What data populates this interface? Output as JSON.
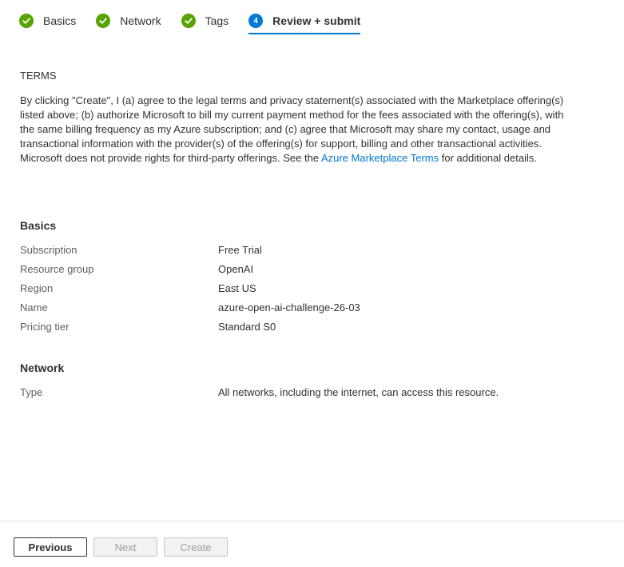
{
  "steps": [
    {
      "label": "Basics",
      "state": "done"
    },
    {
      "label": "Network",
      "state": "done"
    },
    {
      "label": "Tags",
      "state": "done"
    },
    {
      "label": "Review + submit",
      "state": "current",
      "number": "4"
    }
  ],
  "terms": {
    "title": "TERMS",
    "text_before_link": "By clicking \"Create\", I (a) agree to the legal terms and privacy statement(s) associated with the Marketplace offering(s) listed above; (b) authorize Microsoft to bill my current payment method for the fees associated with the offering(s), with the same billing frequency as my Azure subscription; and (c) agree that Microsoft may share my contact, usage and transactional information with the provider(s) of the offering(s) for support, billing and other transactional activities. Microsoft does not provide rights for third-party offerings. See the ",
    "link_text": "Azure Marketplace Terms",
    "text_after_link": " for additional details."
  },
  "basics": {
    "title": "Basics",
    "rows": [
      {
        "label": "Subscription",
        "value": "Free Trial"
      },
      {
        "label": "Resource group",
        "value": "OpenAI"
      },
      {
        "label": "Region",
        "value": "East US"
      },
      {
        "label": "Name",
        "value": "azure-open-ai-challenge-26-03"
      },
      {
        "label": "Pricing tier",
        "value": "Standard S0"
      }
    ]
  },
  "network": {
    "title": "Network",
    "rows": [
      {
        "label": "Type",
        "value": "All networks, including the internet, can access this resource."
      }
    ]
  },
  "footer": {
    "previous_label": "Previous",
    "next_label": "Next",
    "create_label": "Create"
  },
  "colors": {
    "done": "#57a300",
    "current": "#0078d4",
    "link": "#0078d4"
  }
}
